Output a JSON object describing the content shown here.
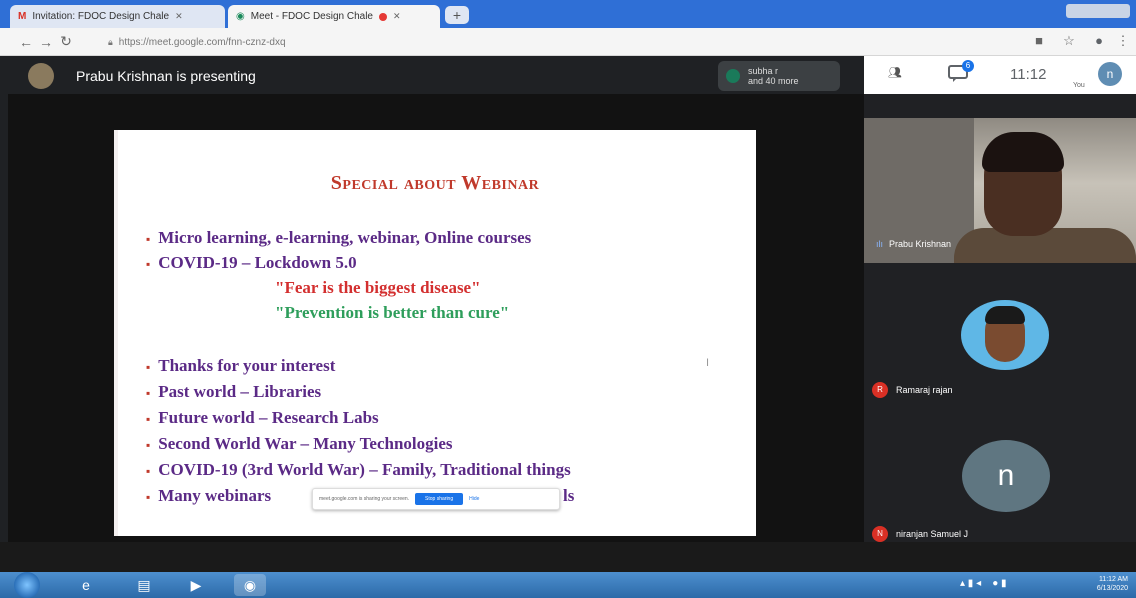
{
  "browser": {
    "tabs": [
      {
        "label": "Invitation: FDOC Design Chale"
      },
      {
        "label": "Meet - FDOC Design Chale"
      }
    ],
    "url": "https://meet.google.com/fnn-cznz-dxq"
  },
  "meet": {
    "presenting_text": "Prabu Krishnan is presenting",
    "participants": {
      "line1": "subha r",
      "line2": "and 40 more"
    },
    "clock": "11:12",
    "you_label": "You",
    "self_avatar_letter": "n",
    "chat_badge": "6"
  },
  "slide": {
    "title": "Special about Webinar",
    "bullets_top": [
      "Micro learning, e-learning, webinar, Online courses",
      "COVID-19 – Lockdown 5.0"
    ],
    "quotes": [
      "\"Fear is the biggest disease\"",
      "\"Prevention is better than cure\""
    ],
    "bullets_bottom": [
      "Thanks for your interest",
      "Past world – Libraries",
      "Future world – Research Labs",
      "Second World War – Many Technologies",
      "COVID-19 (3rd World War) – Family, Traditional things",
      "Many webinars"
    ],
    "last_bullet_tail": "ls"
  },
  "share_banner": {
    "text": "meet.google.com is sharing your screen.",
    "stop_label": "Stop sharing",
    "hide_label": "Hide"
  },
  "tiles": [
    {
      "name": "Prabu Krishnan"
    },
    {
      "name": "Ramaraj rajan",
      "chip": "R"
    },
    {
      "name": "niranjan Samuel J",
      "chip": "N",
      "avatar_letter": "n"
    }
  ],
  "taskbar": {
    "time": "11:12 AM",
    "date": "6/13/2020"
  },
  "colors": {
    "title_red": "#c0392b",
    "bullet_purple": "#5b2a86",
    "quote_red": "#d32f2f",
    "quote_green": "#2e9e5b",
    "meet_blue": "#1a73e8"
  }
}
